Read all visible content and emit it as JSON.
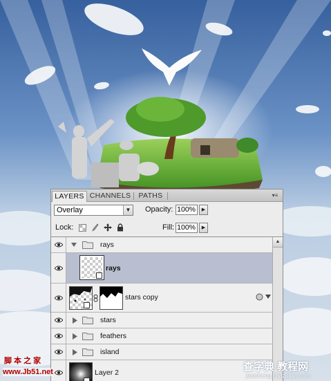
{
  "panel": {
    "tabs": [
      {
        "label": "LAYERS",
        "active": true
      },
      {
        "label": "CHANNELS",
        "active": false
      },
      {
        "label": "PATHS",
        "active": false
      }
    ],
    "menu_glyph": "▾≡"
  },
  "controls": {
    "blend_mode": "Overlay",
    "opacity_label": "Opacity:",
    "opacity_value": "100%",
    "lock_label": "Lock:",
    "fill_label": "Fill:",
    "fill_value": "100%",
    "lock_icons": [
      "lock-transparent-icon",
      "lock-brush-icon",
      "lock-move-icon",
      "lock-all-icon"
    ]
  },
  "layers": [
    {
      "name": "rays",
      "kind": "group",
      "expanded": true
    },
    {
      "name": "rays",
      "kind": "layer",
      "selected": true,
      "bold": true
    },
    {
      "name": "stars copy",
      "kind": "layer-with-mask"
    },
    {
      "name": "stars",
      "kind": "group",
      "expanded": false
    },
    {
      "name": "feathers",
      "kind": "group",
      "expanded": false
    },
    {
      "name": "island",
      "kind": "group",
      "expanded": false
    },
    {
      "name": "Layer 2",
      "kind": "layer"
    }
  ],
  "watermarks": {
    "left_cn": "脚 本 之 家",
    "left_url": "www.Jb51.net",
    "right_cn": "查字典 教程网",
    "right_url": "jiaocheng.chazidian.com"
  },
  "colors": {
    "selected_row": "#b9bfd0",
    "sky_top": "#3f6aa6",
    "grass": "#57a52c"
  }
}
